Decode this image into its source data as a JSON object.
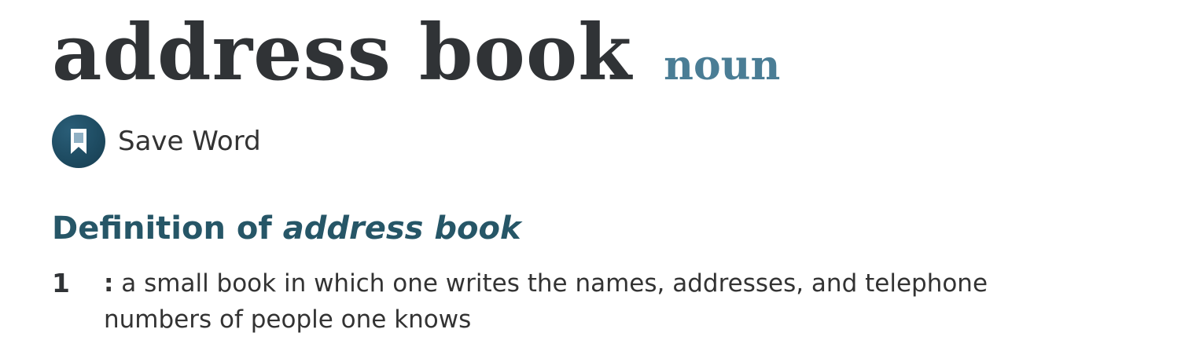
{
  "entry": {
    "headword": "address book",
    "part_of_speech": "noun"
  },
  "save": {
    "label": "Save Word",
    "icon": "bookmark-icon",
    "accent_color": "#1d4a60"
  },
  "definition": {
    "heading_prefix": "Definition of ",
    "heading_word": "address book",
    "heading_color": "#265667",
    "senses": [
      {
        "number": "1",
        "colon": ":",
        "text": " a small book in which one writes the names, addresses, and telephone numbers of people one knows"
      }
    ]
  }
}
